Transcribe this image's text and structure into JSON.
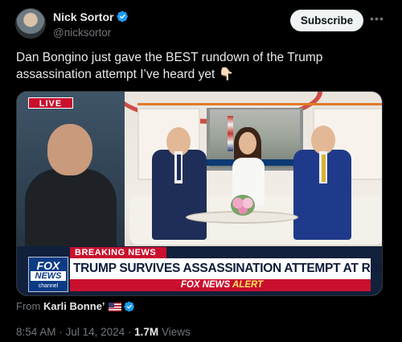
{
  "author": {
    "name": "Nick Sortor",
    "handle": "@nicksortor",
    "avatar_icon": "avatar",
    "verified_icon": "verified-badge-icon"
  },
  "actions": {
    "subscribe_label": "Subscribe",
    "more_icon": "more-icon"
  },
  "tweet": {
    "text": "Dan Bongino just gave the BEST rundown of the Trump assassination attempt I’ve heard yet 👇🏻"
  },
  "media": {
    "live_label": "LIVE",
    "breaking_label": "BREAKING NEWS",
    "headline": "TRUMP SURVIVES ASSASSINATION ATTEMPT AT RALLY",
    "alert_prefix": "FOX NEWS",
    "alert_word": "ALERT",
    "logo": {
      "fox": "FOX",
      "news": "NEWS",
      "channel": "channel"
    },
    "colors": {
      "live_red": "#c8102e",
      "fox_blue": "#0c3b86",
      "alert_yellow": "#ffe45c"
    }
  },
  "source": {
    "from_label": "From",
    "from_name": "Karli Bonne’",
    "flag_icon": "us-flag-icon"
  },
  "meta": {
    "time": "8:54 AM",
    "separator": "·",
    "date": "Jul 14, 2024",
    "views_count": "1.7M",
    "views_label": "Views"
  },
  "colors": {
    "background": "#000000",
    "primary_text": "#e7e9ea",
    "secondary_text": "#71767b",
    "verified_blue": "#1d9bf0"
  }
}
